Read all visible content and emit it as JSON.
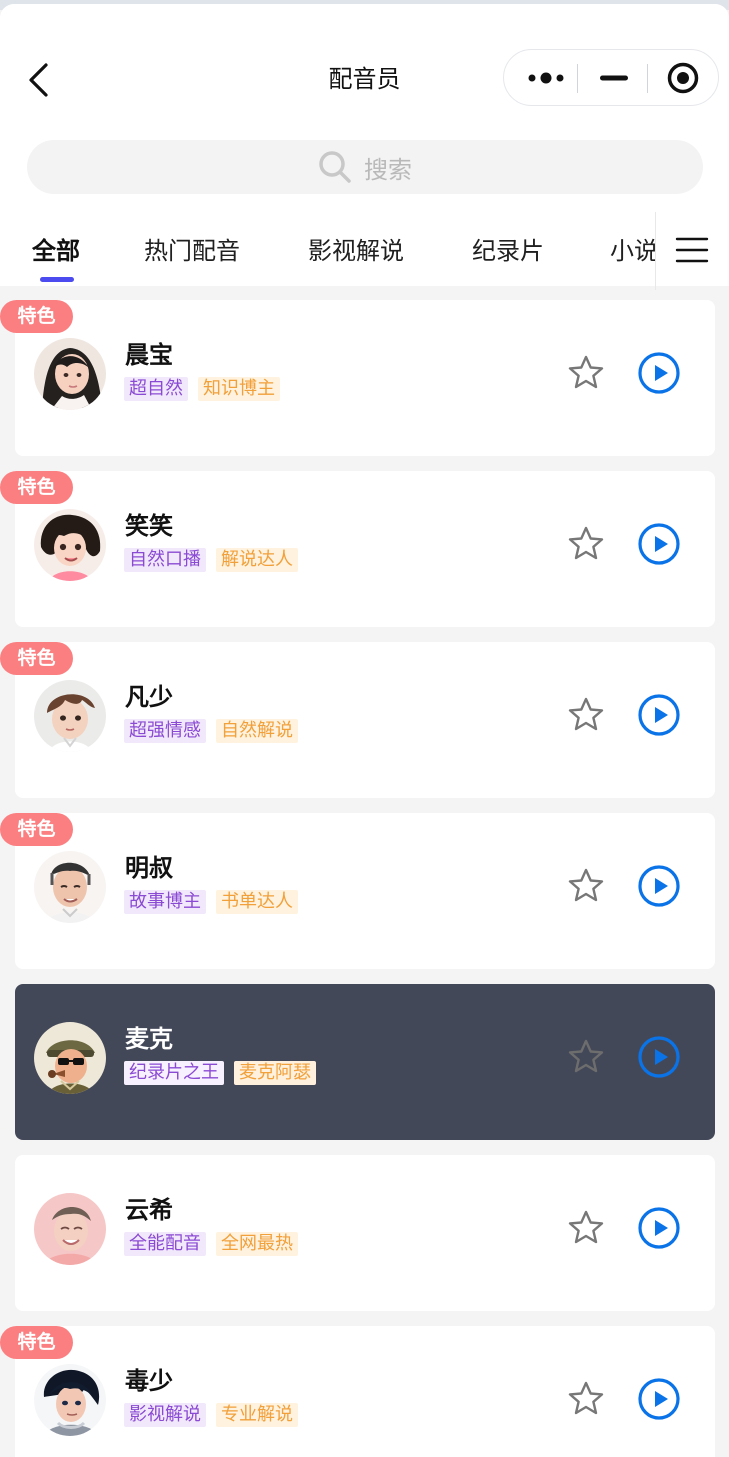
{
  "header": {
    "title": "配音员",
    "search_placeholder": "搜索"
  },
  "tabs": [
    {
      "label": "全部",
      "active": true
    },
    {
      "label": "热门配音",
      "active": false
    },
    {
      "label": "影视解说",
      "active": false
    },
    {
      "label": "纪录片",
      "active": false
    },
    {
      "label": "小说",
      "active": false
    }
  ],
  "icons": {
    "back": "chevron-left-icon",
    "more": "more-dots-icon",
    "minimize": "minus-icon",
    "close": "target-icon",
    "search": "search-icon",
    "menu": "hamburger-icon",
    "favorite": "star-outline-icon",
    "play": "play-circle-icon"
  },
  "voices": [
    {
      "name": "晨宝",
      "featured_label": "特色",
      "tags": [
        "超自然",
        "知识博主"
      ],
      "selected": false
    },
    {
      "name": "笑笑",
      "featured_label": "特色",
      "tags": [
        "自然口播",
        "解说达人"
      ],
      "selected": false
    },
    {
      "name": "凡少",
      "featured_label": "特色",
      "tags": [
        "超强情感",
        "自然解说"
      ],
      "selected": false
    },
    {
      "name": "明叔",
      "featured_label": "特色",
      "tags": [
        "故事博主",
        "书单达人"
      ],
      "selected": false
    },
    {
      "name": "麦克",
      "featured_label": "",
      "tags": [
        "纪录片之王",
        "麦克阿瑟"
      ],
      "selected": true
    },
    {
      "name": "云希",
      "featured_label": "",
      "tags": [
        "全能配音",
        "全网最热"
      ],
      "selected": false
    },
    {
      "name": "毒少",
      "featured_label": "特色",
      "tags": [
        "影视解说",
        "专业解说"
      ],
      "selected": false
    }
  ],
  "colors": {
    "active_tab_indicator": "#4B4BF0",
    "featured_badge": "#FB7F81",
    "selected_card": "#434858",
    "play_icon": "#0A73E8",
    "tag_purple": "#8B4AD3",
    "tag_orange": "#F1A03A"
  }
}
